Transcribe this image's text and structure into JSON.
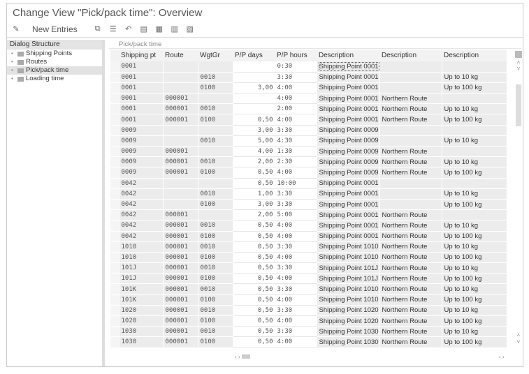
{
  "title": "Change View \"Pick/pack time\": Overview",
  "toolbar": {
    "new_entries": "New Entries",
    "icons": [
      "glasses-pencil-icon",
      "copy-icon",
      "delete-icon",
      "undo-icon",
      "select-all-icon",
      "select-block-icon",
      "deselect-all-icon",
      "configure-icon"
    ]
  },
  "dialog": {
    "header": "Dialog Structure",
    "items": [
      {
        "label": "Shipping Points"
      },
      {
        "label": "Routes"
      },
      {
        "label": "Pick/pack time",
        "selected": true
      },
      {
        "label": "Loading time"
      }
    ]
  },
  "panel": {
    "title": "Pick/pack time"
  },
  "columns": [
    "Shipping pt",
    "Route",
    "WgtGr",
    "P/P days",
    "P/P hours",
    "Description",
    "Description",
    "Description"
  ],
  "rows": [
    [
      "0001",
      "",
      "",
      "",
      "0:30",
      "Shipping Point 0001",
      "",
      ""
    ],
    [
      "0001",
      "",
      "0010",
      "",
      "3:30",
      "Shipping Point 0001",
      "",
      "Up to 10 kg"
    ],
    [
      "0001",
      "",
      "0100",
      "3,00",
      "4:00",
      "Shipping Point 0001",
      "",
      "Up to 100 kg"
    ],
    [
      "0001",
      "000001",
      "",
      "",
      "4:00",
      "Shipping Point 0001",
      "Northern Route",
      ""
    ],
    [
      "0001",
      "000001",
      "0010",
      "",
      "2:00",
      "Shipping Point 0001",
      "Northern Route",
      "Up to 10 kg"
    ],
    [
      "0001",
      "000001",
      "0100",
      "0,50",
      "4:00",
      "Shipping Point 0001",
      "Northern Route",
      "Up to 100 kg"
    ],
    [
      "0009",
      "",
      "",
      "3,00",
      "3:30",
      "Shipping Point 0009",
      "",
      ""
    ],
    [
      "0009",
      "",
      "0010",
      "5,00",
      "4:30",
      "Shipping Point 0009",
      "",
      "Up to 10 kg"
    ],
    [
      "0009",
      "000001",
      "",
      "4,00",
      "1:30",
      "Shipping Point 0009",
      "Northern Route",
      ""
    ],
    [
      "0009",
      "000001",
      "0010",
      "2,00",
      "2:30",
      "Shipping Point 0009",
      "Northern Route",
      "Up to 10 kg"
    ],
    [
      "0009",
      "000001",
      "0100",
      "0,50",
      "4:00",
      "Shipping Point 0009",
      "Northern Route",
      "Up to 100 kg"
    ],
    [
      "0042",
      "",
      "",
      "0,50",
      "10:00",
      "Shipping Point 0001",
      "",
      ""
    ],
    [
      "0042",
      "",
      "0010",
      "1,00",
      "3:30",
      "Shipping Point 0001",
      "",
      "Up to 10 kg"
    ],
    [
      "0042",
      "",
      "0100",
      "3,00",
      "3:30",
      "Shipping Point 0001",
      "",
      "Up to 100 kg"
    ],
    [
      "0042",
      "000001",
      "",
      "2,00",
      "5:00",
      "Shipping Point 0001",
      "Northern Route",
      ""
    ],
    [
      "0042",
      "000001",
      "0010",
      "0,50",
      "4:00",
      "Shipping Point 0001",
      "Northern Route",
      "Up to 10 kg"
    ],
    [
      "0042",
      "000001",
      "0100",
      "0,50",
      "4:00",
      "Shipping Point 0001",
      "Northern Route",
      "Up to 100 kg"
    ],
    [
      "1010",
      "000001",
      "0010",
      "0,50",
      "3:30",
      "Shipping Point 1010",
      "Northern Route",
      "Up to 10 kg"
    ],
    [
      "1010",
      "000001",
      "0100",
      "0,50",
      "4:00",
      "Shipping Point 1010",
      "Northern Route",
      "Up to 100 kg"
    ],
    [
      "101J",
      "000001",
      "0010",
      "0,50",
      "3:30",
      "Shipping Point 101J",
      "Northern Route",
      "Up to 10 kg"
    ],
    [
      "101J",
      "000001",
      "0100",
      "0,50",
      "4:00",
      "Shipping Point 101J",
      "Northern Route",
      "Up to 100 kg"
    ],
    [
      "101K",
      "000001",
      "0010",
      "0,50",
      "3:30",
      "Shipping Point 1010",
      "Northern Route",
      "Up to 10 kg"
    ],
    [
      "101K",
      "000001",
      "0100",
      "0,50",
      "4:00",
      "Shipping Point 1010",
      "Northern Route",
      "Up to 100 kg"
    ],
    [
      "1020",
      "000001",
      "0010",
      "0,50",
      "3:30",
      "Shipping Point 1020",
      "Northern Route",
      "Up to 10 kg"
    ],
    [
      "1020",
      "000001",
      "0100",
      "0,50",
      "4:00",
      "Shipping Point 1020",
      "Northern Route",
      "Up to 100 kg"
    ],
    [
      "1030",
      "000001",
      "0010",
      "0,50",
      "3:30",
      "Shipping Point 1030",
      "Northern Route",
      "Up to 10 kg"
    ],
    [
      "1030",
      "000001",
      "0100",
      "0,50",
      "4:00",
      "Shipping Point 1030",
      "Northern Route",
      "Up to 100 kg"
    ]
  ]
}
